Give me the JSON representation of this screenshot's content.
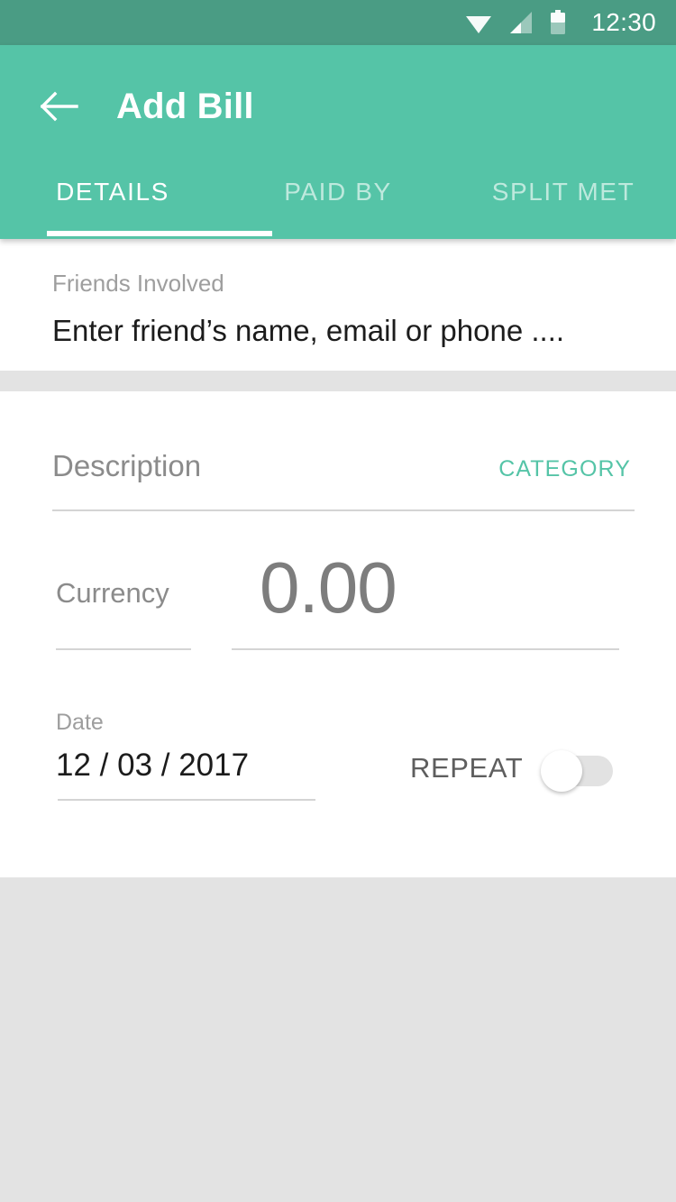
{
  "status_bar": {
    "time": "12:30",
    "icons": [
      "wifi-icon",
      "signal-icon",
      "battery-icon"
    ],
    "background_color": "#4A9C84"
  },
  "app_bar": {
    "title": "Add Bill",
    "back_icon": "back-arrow-icon",
    "background_color": "#55C4A7",
    "tabs": [
      {
        "label": "DETAILS",
        "active": true
      },
      {
        "label": "PAID BY",
        "active": false
      },
      {
        "label": "SPLIT MET",
        "active": false
      }
    ]
  },
  "friends_section": {
    "label": "Friends Involved",
    "placeholder": "Enter friend’s name, email or phone ....",
    "value": ""
  },
  "details_section": {
    "description": {
      "placeholder": "Description",
      "value": ""
    },
    "category_label": "CATEGORY",
    "category_color": "#55C4A7",
    "currency": {
      "placeholder": "Currency",
      "value": ""
    },
    "amount": {
      "value": "0.00"
    },
    "date": {
      "label": "Date",
      "value": "12 / 03 / 2017"
    },
    "repeat": {
      "label": "REPEAT",
      "enabled": false
    }
  }
}
